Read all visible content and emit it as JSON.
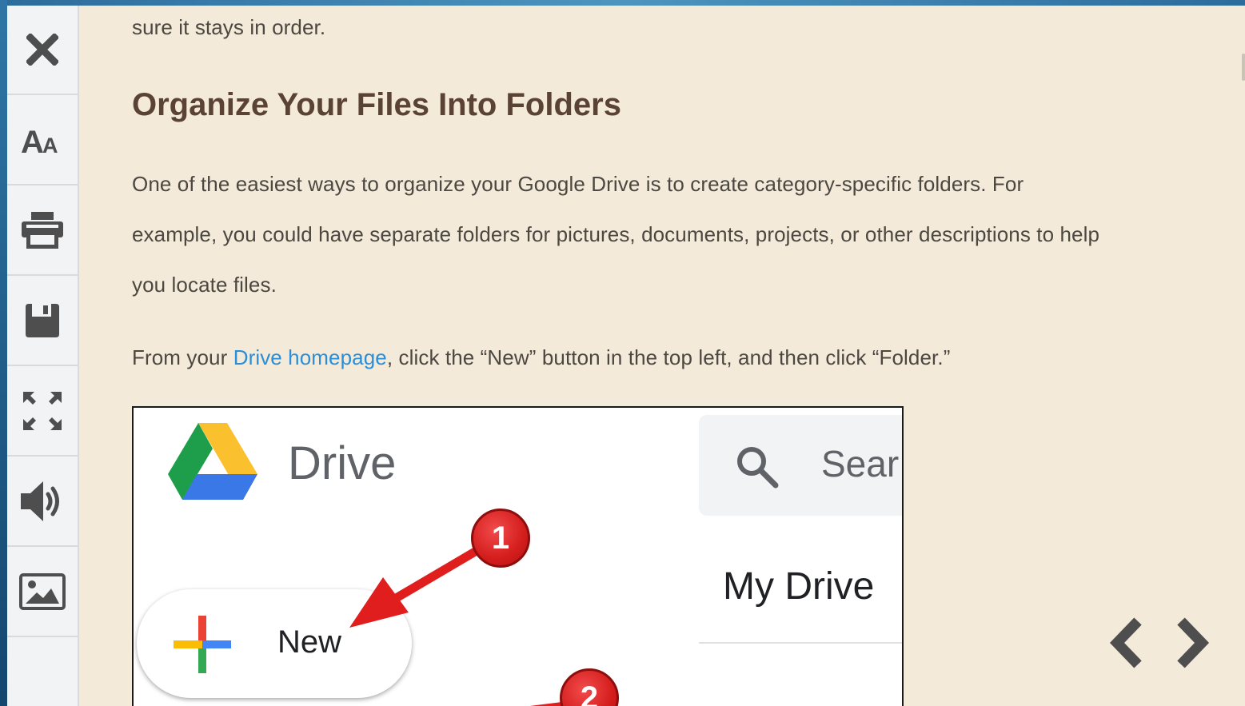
{
  "toolbar": {
    "buttons": [
      {
        "name": "close-button",
        "icon": "close-icon"
      },
      {
        "name": "font-size-button",
        "icon": "font-size-icon",
        "label": "AA"
      },
      {
        "name": "print-button",
        "icon": "printer-icon"
      },
      {
        "name": "save-button",
        "icon": "floppy-disk-icon"
      },
      {
        "name": "fullscreen-button",
        "icon": "expand-icon"
      },
      {
        "name": "read-aloud-button",
        "icon": "speaker-icon"
      },
      {
        "name": "image-button",
        "icon": "image-icon"
      }
    ]
  },
  "article": {
    "intro": "sure it stays in order.",
    "heading": "Organize Your Files Into Folders",
    "para1_line1": "One of the easiest ways to organize your Google Drive is to create category-specific folders. For",
    "para1_line2": "example, you could have separate folders for pictures, documents, projects, or other descriptions to help",
    "para1_line3": "you locate files.",
    "para2_prefix": "From your ",
    "para2_link": "Drive homepage",
    "para2_suffix": ", click the “New” button in the top left, and then click “Folder.”"
  },
  "screenshot": {
    "drive_label": "Drive",
    "search_placeholder": "Sear",
    "my_drive_label": "My Drive",
    "new_button_label": "New",
    "badge1": "1",
    "badge2": "2"
  },
  "nav": {
    "prev_icon": "chevron-left-icon",
    "next_icon": "chevron-right-icon"
  },
  "colors": {
    "page_background": "#f4ead9",
    "heading": "#5a4234",
    "body_text": "#4b4741",
    "link": "#2a8ed8",
    "toolbar_background": "#f2f3f4",
    "icon": "#4e4e4e",
    "badge": "#d41d1d"
  }
}
